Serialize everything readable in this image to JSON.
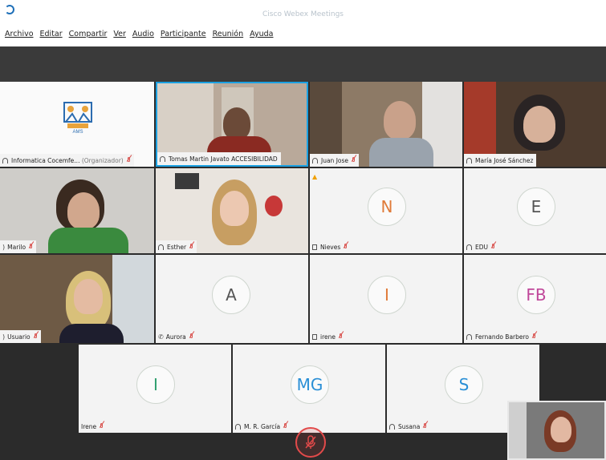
{
  "window": {
    "title": "Cisco Webex Meetings"
  },
  "menu": [
    "Archivo",
    "Editar",
    "Compartir",
    "Ver",
    "Audio",
    "Participante",
    "Reunión",
    "Ayuda"
  ],
  "participants": [
    {
      "name": "Informatica Cocemfe...",
      "role": "(Organizador)",
      "initials": "",
      "muted": true
    },
    {
      "name": "Tomas Martin Javato ACCESIBILIDAD",
      "initials": "",
      "muted": false,
      "active": true
    },
    {
      "name": "Juan Jose",
      "initials": "",
      "muted": true
    },
    {
      "name": "María José Sánchez",
      "initials": "",
      "muted": false
    },
    {
      "name": "Marilo",
      "initials": "",
      "muted": true
    },
    {
      "name": "Esther",
      "initials": "",
      "muted": true
    },
    {
      "name": "Nieves",
      "initials": "N",
      "muted": true
    },
    {
      "name": "EDU",
      "initials": "E",
      "muted": true
    },
    {
      "name": "Usuario",
      "initials": "",
      "muted": true
    },
    {
      "name": "Aurora",
      "initials": "A",
      "muted": true
    },
    {
      "name": "irene",
      "initials": "I",
      "muted": true
    },
    {
      "name": "Fernando Barbero",
      "initials": "FB",
      "muted": true
    },
    {
      "name": "Irene",
      "initials": "I",
      "muted": true
    },
    {
      "name": "M. R. García",
      "initials": "MG",
      "muted": true
    },
    {
      "name": "Susana",
      "initials": "S",
      "muted": true
    }
  ],
  "colors": {
    "active_border": "#1ba1e2",
    "avatar_text": "#e07b39",
    "muted": "#d9534f"
  }
}
